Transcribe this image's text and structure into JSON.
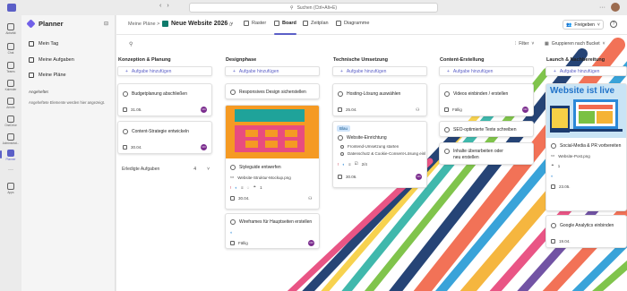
{
  "topbar": {
    "search_placeholder": "Suchen (Ctrl+Alt+E)",
    "back": "‹",
    "forward": "›",
    "more": "···"
  },
  "rail": [
    {
      "label": "Aktivität"
    },
    {
      "label": "Chat"
    },
    {
      "label": "Teams"
    },
    {
      "label": "Kalender"
    },
    {
      "label": "Anrufe"
    },
    {
      "label": "OneDrive"
    },
    {
      "label": "Administrat..."
    },
    {
      "label": "Planner",
      "active": true
    },
    {
      "label": "···"
    },
    {
      "label": "Apps"
    }
  ],
  "sidebar": {
    "title": "Planner",
    "items": [
      {
        "label": "Mein Tag"
      },
      {
        "label": "Meine Aufgaben"
      },
      {
        "label": "Meine Pläne"
      }
    ],
    "pinned_label": "Angeheftet",
    "pinned_note": "Angeheftete Elemente werden hier angezeigt."
  },
  "header": {
    "breadcrumb": "Meine Pläne",
    "breadcrumb_sep": ">",
    "project": "Neue Website 2026",
    "tabs": [
      {
        "label": "Raster"
      },
      {
        "label": "Board",
        "active": true
      },
      {
        "label": "Zeitplan"
      },
      {
        "label": "Diagramme"
      }
    ],
    "share": "Freigeben",
    "help": "?"
  },
  "toolbar": {
    "filter": "Filter",
    "group": "Gruppieren nach Bucket"
  },
  "add_task": "Aufgabe hinzufügen",
  "columns": [
    {
      "title": "Konzeption & Planung"
    },
    {
      "title": "Designphase"
    },
    {
      "title": "Technische Umsetzung"
    },
    {
      "title": "Content-Erstellung"
    },
    {
      "title": "Launch & Nachbereitung"
    }
  ],
  "cards": {
    "c1": {
      "title": "Budgetplanung abschließen",
      "date": "31.05.",
      "avatar": "CD"
    },
    "c2": {
      "title": "Content-Strategie entwickeln",
      "date": "30.04.",
      "avatar": "CD"
    },
    "completed": {
      "label": "Erledigte Aufgaben",
      "count": "4"
    },
    "d1": {
      "title": "Responsives Design sicherstellen"
    },
    "d2": {
      "title": "Styleguide entwerfen",
      "attachment": "Website-Struktur-Mockup.png",
      "comments": "1",
      "date": "30.04."
    },
    "d3": {
      "title": "Wireframes für Hauptseiten erstellen",
      "status": "Fällig",
      "avatar": "CD"
    },
    "t1": {
      "title": "Hosting-Lösung auswählen",
      "date": "25.04."
    },
    "t2": {
      "label": "Blau",
      "title": "Website-Einrichtung",
      "sub1": "Frontend-Umsetzung starten",
      "sub2": "Datenschutz & Cookie-Consent-Lösung einl",
      "checklist": "2/4",
      "date": "30.06.",
      "avatar": "CD"
    },
    "e1": {
      "title": "Videos einbinden / erstellen",
      "status": "Fällig",
      "avatar": "CD"
    },
    "e2": {
      "title": "SEO-optimierte Texte schreiben"
    },
    "e3": {
      "title": "Inhalte überarbeiten oder neu erstellen"
    },
    "l1": {
      "banner": "Website ist live",
      "title": "Social-Media & PR vorbereiten",
      "attachment": "Website-Post.png",
      "comments": "1",
      "date": "23.05."
    },
    "l2": {
      "title": "Google Analytics einbinden",
      "date": "19.04."
    }
  },
  "colors": {
    "accent": "#5b5fc7",
    "avatar": "#7b2d8e",
    "late": "#c4314b",
    "orange": "#f59a23",
    "teal": "#1fa39a",
    "pink": "#e84c7f",
    "blue": "#2b88d8"
  }
}
